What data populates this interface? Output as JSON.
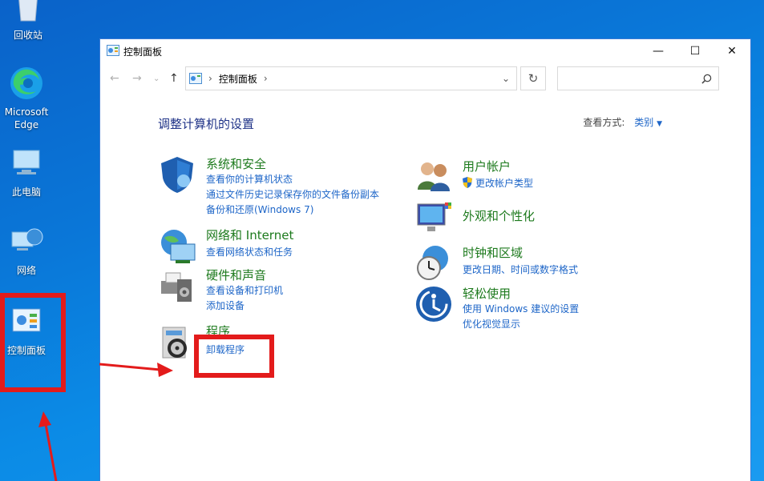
{
  "desktop": {
    "recycle_bin": "回收站",
    "edge": "Microsoft Edge",
    "this_pc": "此电脑",
    "network": "网络",
    "control_panel": "控制面板"
  },
  "window": {
    "title": "控制面板",
    "minimize": "—",
    "maximize": "☐",
    "close": "✕"
  },
  "address": {
    "path": "控制面板",
    "search_placeholder": ""
  },
  "content": {
    "heading": "调整计算机的设置",
    "view_by_label": "查看方式:",
    "view_by_value": "类别"
  },
  "categories_left": [
    {
      "title": "系统和安全",
      "links": [
        "查看你的计算机状态",
        "通过文件历史记录保存你的文件备份副本",
        "备份和还原(Windows 7)"
      ]
    },
    {
      "title": "网络和 Internet",
      "links": [
        "查看网络状态和任务"
      ]
    },
    {
      "title": "硬件和声音",
      "links": [
        "查看设备和打印机",
        "添加设备"
      ]
    },
    {
      "title": "程序",
      "links": [
        "卸载程序"
      ]
    }
  ],
  "categories_right": [
    {
      "title": "用户帐户",
      "links": [
        "更改帐户类型"
      ]
    },
    {
      "title": "外观和个性化",
      "links": []
    },
    {
      "title": "时钟和区域",
      "links": [
        "更改日期、时间或数字格式"
      ]
    },
    {
      "title": "轻松使用",
      "links": [
        "使用 Windows 建议的设置",
        "优化视觉显示"
      ]
    }
  ],
  "colors": {
    "accent_link": "#1e66c8",
    "category_title": "#1d7a1d",
    "annotation": "#e31b1b"
  }
}
